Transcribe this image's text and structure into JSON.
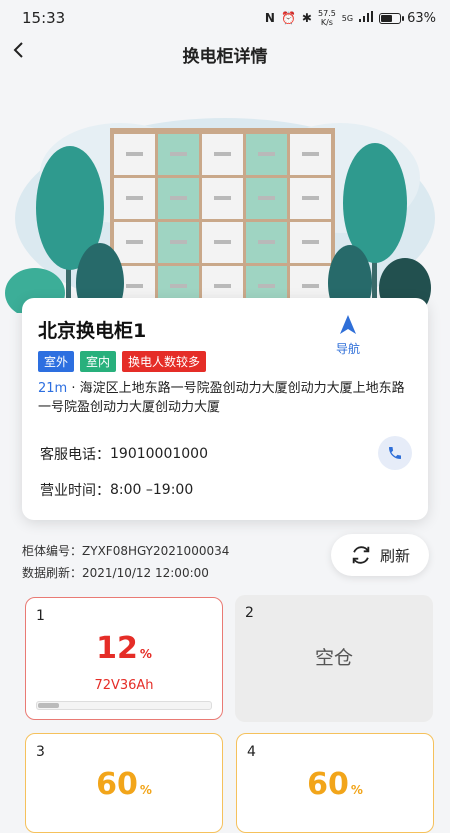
{
  "status_bar": {
    "time": "15:33",
    "speed_value": "57.5",
    "speed_unit": "K/s",
    "signal": "5G",
    "battery": "63%",
    "battery_level": 0.63
  },
  "header": {
    "title": "换电柜详情"
  },
  "station": {
    "name": "北京换电柜1",
    "nav_label": "导航",
    "tags": [
      "室外",
      "室内",
      "换电人数较多"
    ],
    "distance": "21m",
    "address": " · 海淀区上地东路一号院盈创动力大厦创动力大厦上地东路一号院盈创动力大厦创动力大厦",
    "phone_label": "客服电话：",
    "phone": "19010001000",
    "hours_label": "营业时间：",
    "hours": "8:00 –19:00"
  },
  "meta": {
    "cabinet_label": "柜体编号：",
    "cabinet_id": "ZYXF08HGY2021000034",
    "refresh_label": "数据刷新：",
    "refresh_time": "2021/10/12 12:00:00",
    "refresh_button": "刷新"
  },
  "slots": [
    {
      "number": "1",
      "percent": "12",
      "unit": "%",
      "spec": "72V36Ah",
      "level": 0.12,
      "state": "low",
      "color": "#e52d27"
    },
    {
      "number": "2",
      "empty_label": "空仓",
      "state": "empty"
    },
    {
      "number": "3",
      "percent": "60",
      "unit": "%",
      "state": "mid",
      "color": "#f2a51a"
    },
    {
      "number": "4",
      "percent": "60",
      "unit": "%",
      "state": "mid",
      "color": "#f2a51a"
    }
  ]
}
